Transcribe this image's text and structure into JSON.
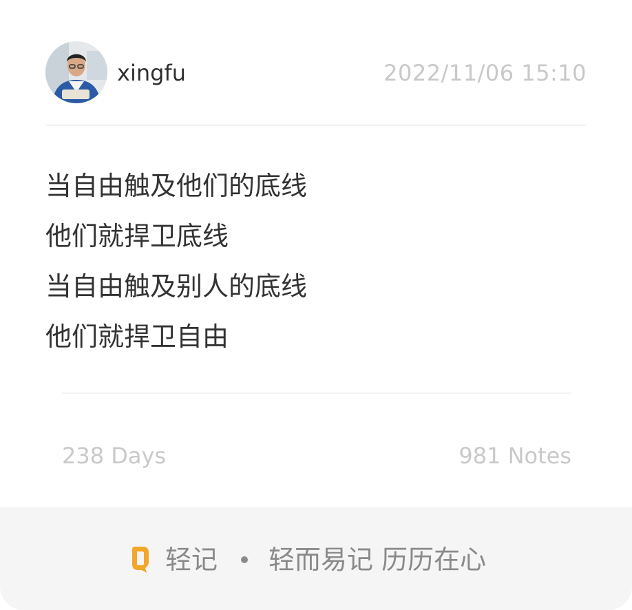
{
  "header": {
    "username": "xingfu",
    "timestamp": "2022/11/06 15:10"
  },
  "content": {
    "lines": [
      "当自由触及他们的底线",
      "他们就捍卫底线",
      "当自由触及别人的底线",
      "他们就捍卫自由"
    ]
  },
  "stats": {
    "days": "238 Days",
    "notes": "981 Notes"
  },
  "footer": {
    "brand": "轻记",
    "slogan": "轻而易记 历历在心",
    "logo_icon": "qingji-logo-icon",
    "accent_color": "#f2a72b"
  }
}
